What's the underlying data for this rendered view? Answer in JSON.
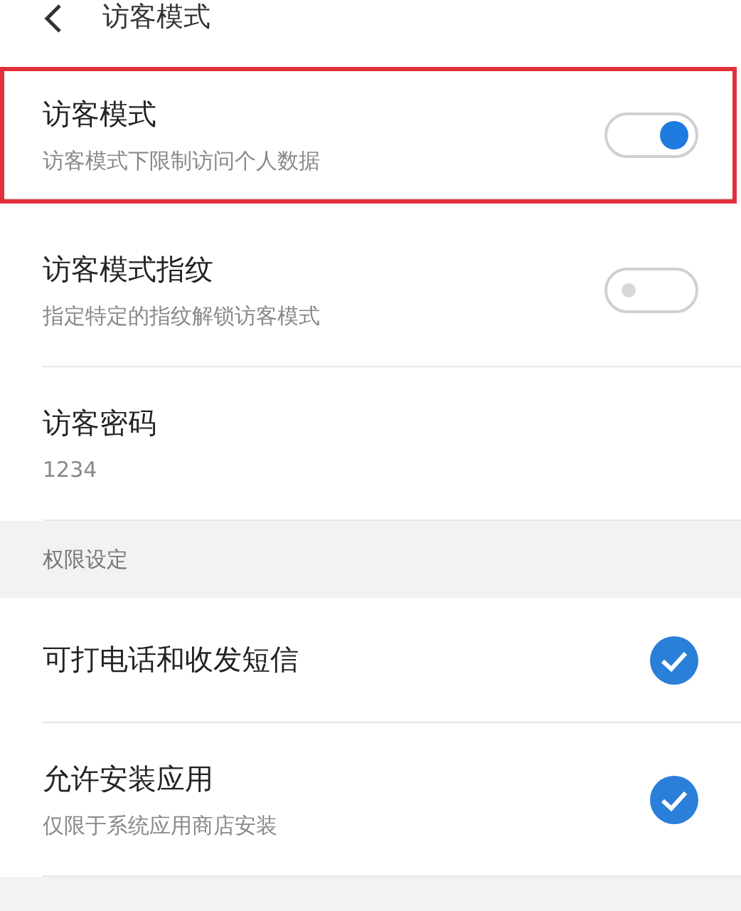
{
  "header": {
    "title": "访客模式"
  },
  "rows": [
    {
      "kind": "toggle",
      "title": "访客模式",
      "subtitle": "访客模式下限制访问个人数据",
      "on": true,
      "highlighted": true
    },
    {
      "kind": "toggle",
      "title": "访客模式指纹",
      "subtitle": "指定特定的指纹解锁访客模式",
      "on": false,
      "highlighted": false
    },
    {
      "kind": "value",
      "title": "访客密码",
      "subtitle": "1234"
    },
    {
      "kind": "section",
      "title": "权限设定"
    },
    {
      "kind": "check",
      "title": "可打电话和收发短信",
      "checked": true
    },
    {
      "kind": "check",
      "title": "允许安装应用",
      "subtitle": "仅限于系统应用商店安装",
      "checked": true
    }
  ]
}
